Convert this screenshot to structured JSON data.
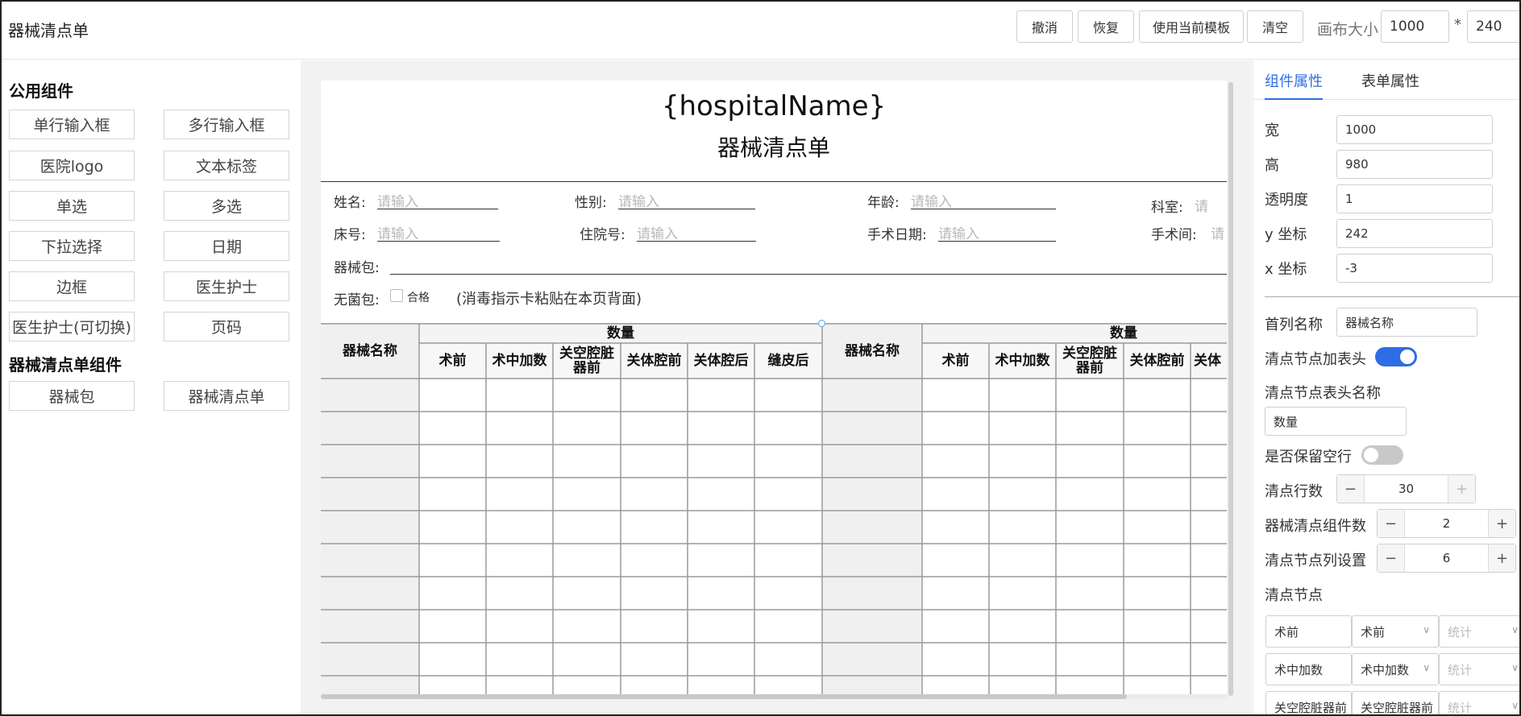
{
  "app": {
    "title": "器械清点单"
  },
  "toolbar": {
    "undo": "撤消",
    "redo": "恢复",
    "use_template": "使用当前模板",
    "clear": "清空",
    "canvas_size_label": "画布大小",
    "canvas_width": "1000",
    "times": "*",
    "canvas_height": "240"
  },
  "left": {
    "common_title": "公用组件",
    "common_items": [
      "单行输入框",
      "多行输入框",
      "医院logo",
      "文本标签",
      "单选",
      "多选",
      "下拉选择",
      "日期",
      "边框",
      "医生护士",
      "医生护士(可切换)",
      "页码"
    ],
    "checklist_title": "器械清点单组件",
    "checklist_items": [
      "器械包",
      "器械清点单"
    ]
  },
  "paper": {
    "hospital_name": "{hospitalName}",
    "form_title": "器械清点单",
    "placeholder": "请输入",
    "fields": {
      "name": "姓名:",
      "gender": "性别:",
      "age": "年龄:",
      "dept": "科室:",
      "bed": "床号:",
      "inpatient": "住院号:",
      "surgery_date": "手术日期:",
      "operating_room": "手术间:",
      "instrument_pack": "器械包:",
      "sterile_pack": "无菌包:",
      "qualified": "合格",
      "sterile_note": "(消毒指示卡粘贴在本页背面)",
      "dept_partial": "请",
      "room_partial": "请"
    },
    "table": {
      "first_col": "器械名称",
      "group_header": "数量",
      "columns": [
        "术前",
        "术中加数",
        "关空腔脏器前",
        "关体腔前",
        "关体腔后",
        "缝皮后"
      ],
      "columns2_visible": [
        "术前",
        "术中加数",
        "关空腔脏器前",
        "关体腔前",
        "关体"
      ]
    }
  },
  "right": {
    "tabs": [
      "组件属性",
      "表单属性"
    ],
    "width_label": "宽",
    "width_value": "1000",
    "height_label": "高",
    "height_value": "980",
    "opacity_label": "透明度",
    "opacity_value": "1",
    "y_label": "y 坐标",
    "y_value": "242",
    "x_label": "x 坐标",
    "x_value": "-3",
    "first_col_label": "首列名称",
    "first_col_value": "器械名称",
    "node_header_label": "清点节点加表头",
    "node_header_on": true,
    "node_header_name_label": "清点节点表头名称",
    "node_header_name_value": "数量",
    "keep_empty_label": "是否保留空行",
    "keep_empty_on": false,
    "rows_label": "清点行数",
    "rows_value": "30",
    "components_label": "器械清点组件数",
    "components_value": "2",
    "cols_label": "清点节点列设置",
    "cols_value": "6",
    "nodes_label": "清点节点",
    "nodes": [
      {
        "name": "术前",
        "select": "术前",
        "stat": "统计"
      },
      {
        "name": "术中加数",
        "select": "术中加数",
        "stat": "统计"
      },
      {
        "name": "关空腔脏器前",
        "select": "关空腔脏器前",
        "stat": "统计"
      }
    ],
    "minus": "−",
    "plus": "+",
    "accent": "#2f6de6"
  }
}
